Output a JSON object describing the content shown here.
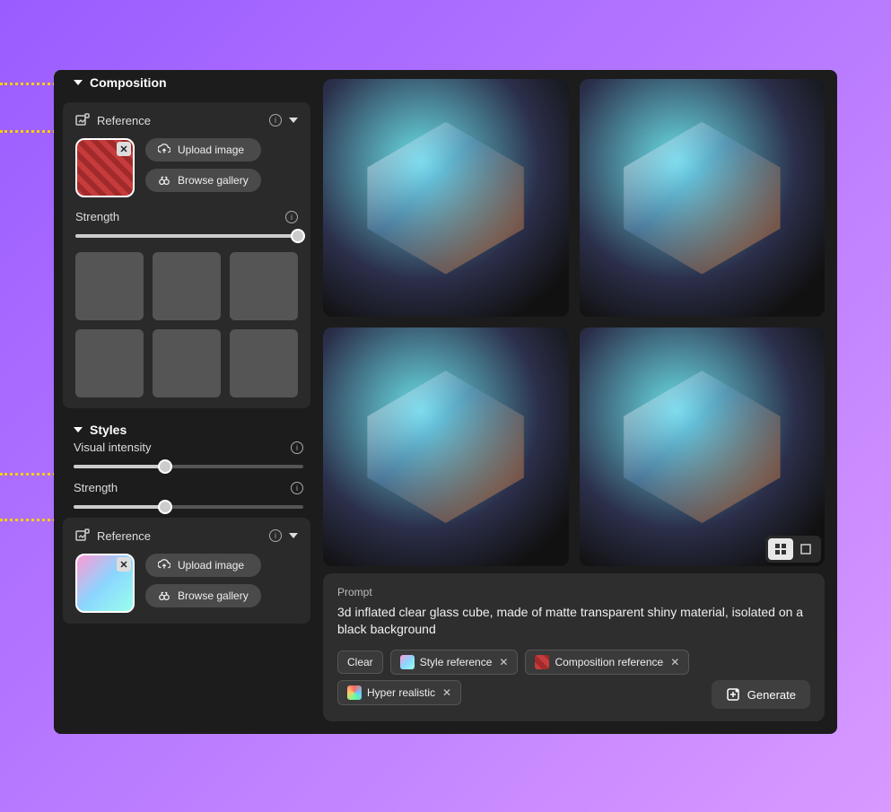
{
  "sidebar": {
    "composition": {
      "title": "Composition",
      "reference_label": "Reference",
      "upload_label": "Upload image",
      "gallery_label": "Browse gallery",
      "strength_label": "Strength",
      "strength_value": 100
    },
    "styles": {
      "title": "Styles",
      "visual_intensity_label": "Visual intensity",
      "visual_intensity_value": 40,
      "strength_label": "Strength",
      "strength_value": 40,
      "reference_label": "Reference",
      "upload_label": "Upload image",
      "gallery_label": "Browse gallery"
    }
  },
  "prompt": {
    "label": "Prompt",
    "text": "3d inflated clear glass cube, made of matte transparent shiny material, isolated on a black background",
    "tags": {
      "clear": "Clear",
      "style_ref": "Style reference",
      "comp_ref": "Composition reference",
      "hyper": "Hyper realistic"
    },
    "generate_label": "Generate"
  }
}
